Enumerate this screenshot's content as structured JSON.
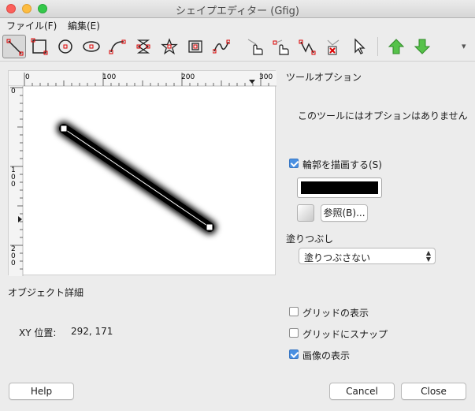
{
  "window": {
    "title": "シェイプエディター (Gfig)"
  },
  "menu": {
    "file": "ファイル(F)",
    "edit": "編集(E)"
  },
  "toolbar": {
    "tools": [
      "line-tool",
      "rectangle-tool",
      "circle-tool",
      "ellipse-tool",
      "arc-tool",
      "polygon-tool",
      "star-tool",
      "spiral-tool",
      "bezier-tool",
      "move-object-tool",
      "move-point-tool",
      "copy-object-tool",
      "delete-object-tool",
      "select-object-tool"
    ],
    "raise": "raise-arrow",
    "lower": "lower-arrow",
    "overflow": "▾"
  },
  "ruler": {
    "h_ticks": [
      "0",
      "100",
      "200",
      "300"
    ],
    "v_ticks": [
      "0",
      "1\n0\n0",
      "2\n0\n0"
    ]
  },
  "tool_options": {
    "heading": "ツールオプション",
    "no_options": "このツールにはオプションはありません"
  },
  "stroke": {
    "label": "輪郭を描画する(S)",
    "checked": true,
    "color": "#000000",
    "browse_label": "参照(B)..."
  },
  "fill": {
    "label": "塗りつぶし",
    "selected": "塗りつぶさない"
  },
  "object_details": {
    "heading": "オブジェクト詳細",
    "xy_label": "XY 位置:",
    "xy_value": "292, 171"
  },
  "options": {
    "show_grid": {
      "label": "グリッドの表示",
      "checked": false
    },
    "snap_grid": {
      "label": "グリッドにスナップ",
      "checked": false
    },
    "show_image": {
      "label": "画像の表示",
      "checked": true
    }
  },
  "buttons": {
    "help": "Help",
    "cancel": "Cancel",
    "close": "Close"
  },
  "colors": {
    "accent": "#4a90e2",
    "arrow_green": "#3cb034"
  }
}
